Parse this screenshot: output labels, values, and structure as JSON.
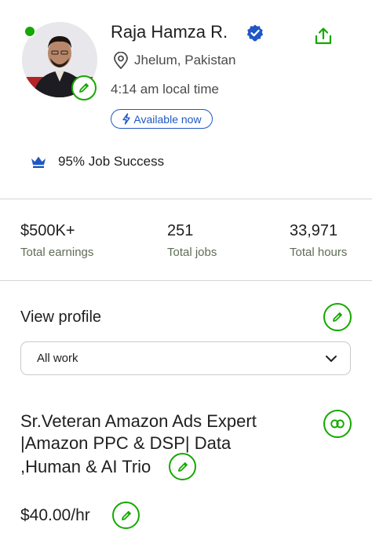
{
  "profile": {
    "name": "Raja Hamza R.",
    "location": "Jhelum, Pakistan",
    "local_time": "4:14 am local time",
    "availability": "Available now",
    "job_success": "95% Job Success"
  },
  "stats": [
    {
      "value": "$500K+",
      "label": "Total earnings"
    },
    {
      "value": "251",
      "label": "Total jobs"
    },
    {
      "value": "33,971",
      "label": "Total hours"
    }
  ],
  "view_profile": {
    "heading": "View profile",
    "select_value": "All work"
  },
  "title_lines": [
    "Sr.Veteran Amazon Ads Expert",
    "|Amazon PPC & DSP| Data",
    ",Human & AI Trio"
  ],
  "rate": "$40.00/hr",
  "colors": {
    "accent_green": "#14a800",
    "accent_blue": "#1f57c3",
    "divider": "#d5d5d5"
  },
  "icons": [
    "online-status-icon",
    "pencil-icon",
    "verified-badge-icon",
    "share-icon",
    "map-pin-icon",
    "bolt-icon",
    "crown-icon",
    "chevron-down-icon",
    "link-icon"
  ]
}
